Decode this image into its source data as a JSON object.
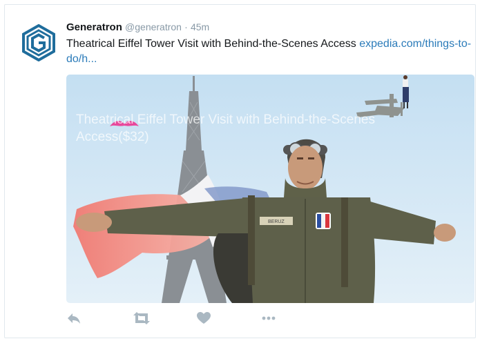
{
  "tweet": {
    "author_name": "Generatron",
    "handle": "@generatron",
    "separator": "·",
    "time": "45m",
    "text": "Theatrical Eiffel Tower Visit with Behind-the-Scenes Access",
    "link_text": "expedia.com/things-to-do/h...",
    "media_overlay": "Theatrical Eiffel Tower Visit with Behind-the-Scenes Access($32)",
    "badge_text": "BERUZ"
  },
  "icons": {
    "avatar": "generatron-hexagon-logo",
    "reply": "reply-icon",
    "retweet": "retweet-icon",
    "like": "heart-icon",
    "more": "more-icon"
  },
  "colors": {
    "link": "#2b7bb9",
    "avatar": "#1f6d9c",
    "icon": "#aab8c2",
    "mustache": "#e8489b",
    "sky": "#c9e2f2"
  }
}
